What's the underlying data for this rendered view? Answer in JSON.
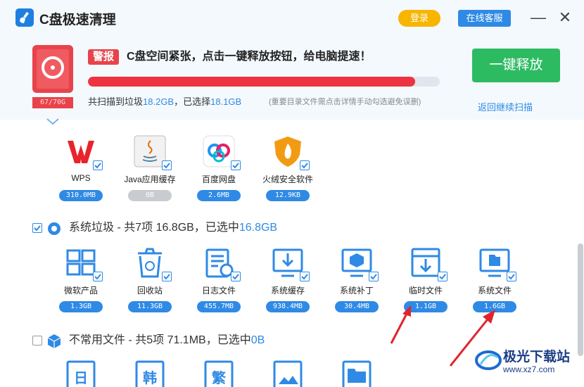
{
  "titlebar": {
    "title": "C盘极速清理",
    "login": "登录",
    "service": "在线客服",
    "minimize": "—",
    "close": "✕"
  },
  "header": {
    "alert_badge": "警报",
    "alert_text": "C盘空间紧张，点击一键释放按钮，给电脑提速！",
    "disk_usage": "67/70G",
    "progress": 0.93,
    "scan_prefix": "共扫描到垃圾",
    "scan_total": "18.2GB",
    "scan_mid": "，已选择",
    "scan_selected": "18.1GB",
    "scan_tip": "(重要目录文件需点击详情手动勾选避免误删)",
    "release_button": "一键释放",
    "rescan_link": "返回继续扫描"
  },
  "apps": [
    {
      "label": "WPS",
      "size": "310.0MB",
      "icon": "wps-icon",
      "checked": true
    },
    {
      "label": "Java应用缓存",
      "size": "0B",
      "icon": "java-icon",
      "checked": true
    },
    {
      "label": "百度网盘",
      "size": "2.6MB",
      "icon": "baidu-netdisk-icon",
      "checked": true
    },
    {
      "label": "火绒安全软件",
      "size": "12.9KB",
      "icon": "huorong-icon",
      "checked": true
    }
  ],
  "system_section": {
    "title": "系统垃圾 - 共7项 16.8GB，已选中",
    "selected": "16.8GB",
    "checked": true,
    "items": [
      {
        "label": "微软产品",
        "size": "1.3GB",
        "icon": "windows-icon"
      },
      {
        "label": "回收站",
        "size": "11.3GB",
        "icon": "recycle-bin-icon"
      },
      {
        "label": "日志文件",
        "size": "455.7MB",
        "icon": "log-file-icon"
      },
      {
        "label": "系统缓存",
        "size": "938.4MB",
        "icon": "system-cache-icon"
      },
      {
        "label": "系统补丁",
        "size": "30.4MB",
        "icon": "system-patch-icon"
      },
      {
        "label": "临时文件",
        "size": "1.1GB",
        "icon": "temp-file-icon"
      },
      {
        "label": "系统文件",
        "size": "1.6GB",
        "icon": "system-file-icon"
      }
    ]
  },
  "rare_section": {
    "title": "不常用文件 - 共5项 71.1MB，已选中",
    "selected": "0B",
    "checked": false,
    "items": [
      {
        "glyph": "日",
        "icon": "japanese-file-icon"
      },
      {
        "glyph": "韩",
        "icon": "korean-file-icon"
      },
      {
        "glyph": "繁",
        "icon": "traditional-file-icon"
      },
      {
        "glyph": "",
        "icon": "image-file-icon"
      },
      {
        "glyph": "",
        "icon": "folder-file-icon"
      }
    ]
  },
  "watermark": {
    "main": "极光下载站",
    "sub": "www.xz7.com"
  },
  "colors": {
    "accent": "#2f8ae5",
    "alert": "#e8434b",
    "release": "#2dbb62",
    "login": "#f7b500"
  }
}
